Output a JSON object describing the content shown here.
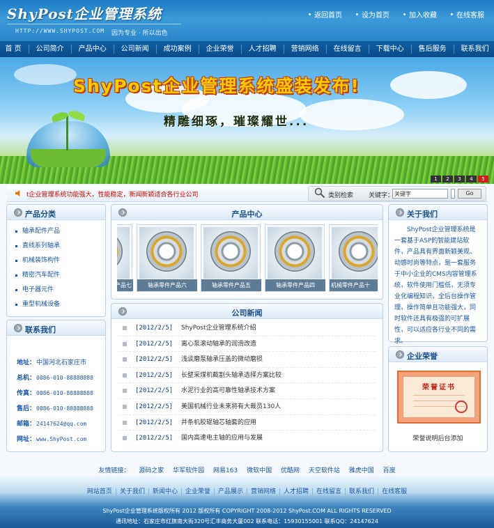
{
  "header": {
    "logo": "ShyPost企业管理系统",
    "url": "HTTP://WWW.SHYPOST.COM",
    "slogan": "因为专业 · 所以出色",
    "top_links": [
      "返回首页",
      "设为首页",
      "加入收藏",
      "在线客服"
    ]
  },
  "nav": [
    "首 页",
    "公司简介",
    "产品中心",
    "公司新闻",
    "成功案例",
    "企业荣誉",
    "人才招聘",
    "营销网络",
    "在线留言",
    "下载中心",
    "售后服务",
    "联系我们"
  ],
  "banner": {
    "title": "ShyPost企业管理系统盛装发布!",
    "subtitle": "精雕细琢，璀璨耀世...",
    "slides": [
      "1",
      "2",
      "3",
      "4",
      "5"
    ],
    "active_slide": "5"
  },
  "notice": {
    "text": "t企业管理系统功能强大，性能稳定，新闻新颖适合各行业公司"
  },
  "search": {
    "label": "类别检索",
    "keyword_label": "关键字：",
    "keyword_value": "关键字",
    "button": "Go"
  },
  "categories": {
    "title": "产品分类",
    "items": [
      "轴承配件产品",
      "直线系列轴承",
      "机械装饰构件",
      "精密汽车配件",
      "电子器元件",
      "重型机械设备"
    ]
  },
  "contact": {
    "title": "联系我们",
    "rows": [
      {
        "label": "地址：",
        "value": "中国河北石家庄市"
      },
      {
        "label": "总机：",
        "value": "0086-010-88888888"
      },
      {
        "label": "传真：",
        "value": "0086-010-88888888"
      },
      {
        "label": "售后：",
        "value": "0086-010-88888888"
      },
      {
        "label": "邮箱：",
        "value": "24147624@qq.com"
      },
      {
        "label": "网址：",
        "value": "www.ShyPost.com"
      }
    ]
  },
  "products": {
    "title": "产品中心",
    "items": [
      "轴承零件产品七",
      "轴承零件产品六",
      "轴承零件产品五",
      "轴承零件产品四",
      "机械零件产品十"
    ]
  },
  "news": {
    "title": "公司新闻",
    "items": [
      {
        "date": "[2012/2/5]",
        "title": "ShyPost企业管理系统介绍"
      },
      {
        "date": "[2012/2/5]",
        "title": "离心泵滚动轴承的润滑改造"
      },
      {
        "date": "[2012/2/5]",
        "title": "浅谈磨泵轴承压盖的微动磨损"
      },
      {
        "date": "[2012/2/5]",
        "title": "长壁采煤机截割头轴承选择方案比较"
      },
      {
        "date": "[2012/2/5]",
        "title": "水泥行业的高可靠性轴承技术方案"
      },
      {
        "date": "[2012/2/5]",
        "title": "美国机械行业未来将有大裁员130人"
      },
      {
        "date": "[2012/2/5]",
        "title": "并条机胶辊轴芯轴套的应用"
      },
      {
        "date": "[2012/2/5]",
        "title": "国内高速电主轴的应用与发展"
      }
    ]
  },
  "about": {
    "title": "关于我们",
    "text": "ShyPost企业管理系统是一套基于ASP的智能建站软件，产品具有界面新颖美观、动感时尚等特点，是一套服务于中小企业的CMS内容管理系统，软件使用门槛低，无须专业化编程知识，全后台操作管理，操作简单且功能强大，同时软件还具有极强的可扩展性，可以适应各行业不同的需求。",
    "more": "..."
  },
  "honor": {
    "title": "企业荣誉",
    "cert_title": "荣誉证书",
    "caption": "荣誉说明后台添加"
  },
  "friend_links": [
    "友情链接：",
    "源码之家",
    "华军软件园",
    "网易163",
    "微软中国",
    "优酷网",
    "天空软件站",
    "雅虎中国",
    "百度"
  ],
  "footer": {
    "nav": [
      "网站首页",
      "关于我们",
      "新闻中心",
      "企业荣誉",
      "产品展示",
      "营销网络",
      "人才招聘",
      "在线留言",
      "联系我们",
      "在线客服"
    ],
    "copyright": "ShyPost企业管理系统版权所有 2012 版权所有 COPYRIGHT 2008-2012 ShyPost.COM ALL RIGHTS RESERVED",
    "address": "通讯地址：石家庄市红旗南大街320号汇丰商务大厦002 联系电话：15930155001 联系QQ：24147624"
  },
  "colors": {
    "primary_blue": "#1d7cc4",
    "nav_blue": "#0f5ea3",
    "link_blue": "#1a56a0",
    "notice_red": "#cc0000",
    "banner_title_yellow": "#ffcc00"
  }
}
